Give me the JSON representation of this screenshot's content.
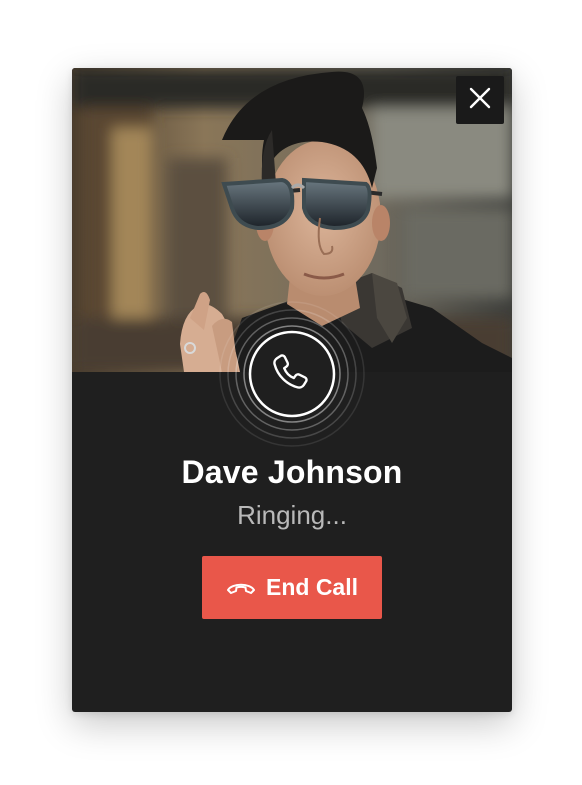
{
  "caller": {
    "name": "Dave Johnson",
    "status": "Ringing..."
  },
  "actions": {
    "end_call_label": "End Call"
  },
  "icons": {
    "close": "close-icon",
    "phone": "phone-icon",
    "hang_up": "hang-up-icon"
  },
  "colors": {
    "card_background": "#1f1f1f",
    "end_call": "#e9574a",
    "name_text": "#ffffff",
    "status_text": "#b9b9b9"
  }
}
